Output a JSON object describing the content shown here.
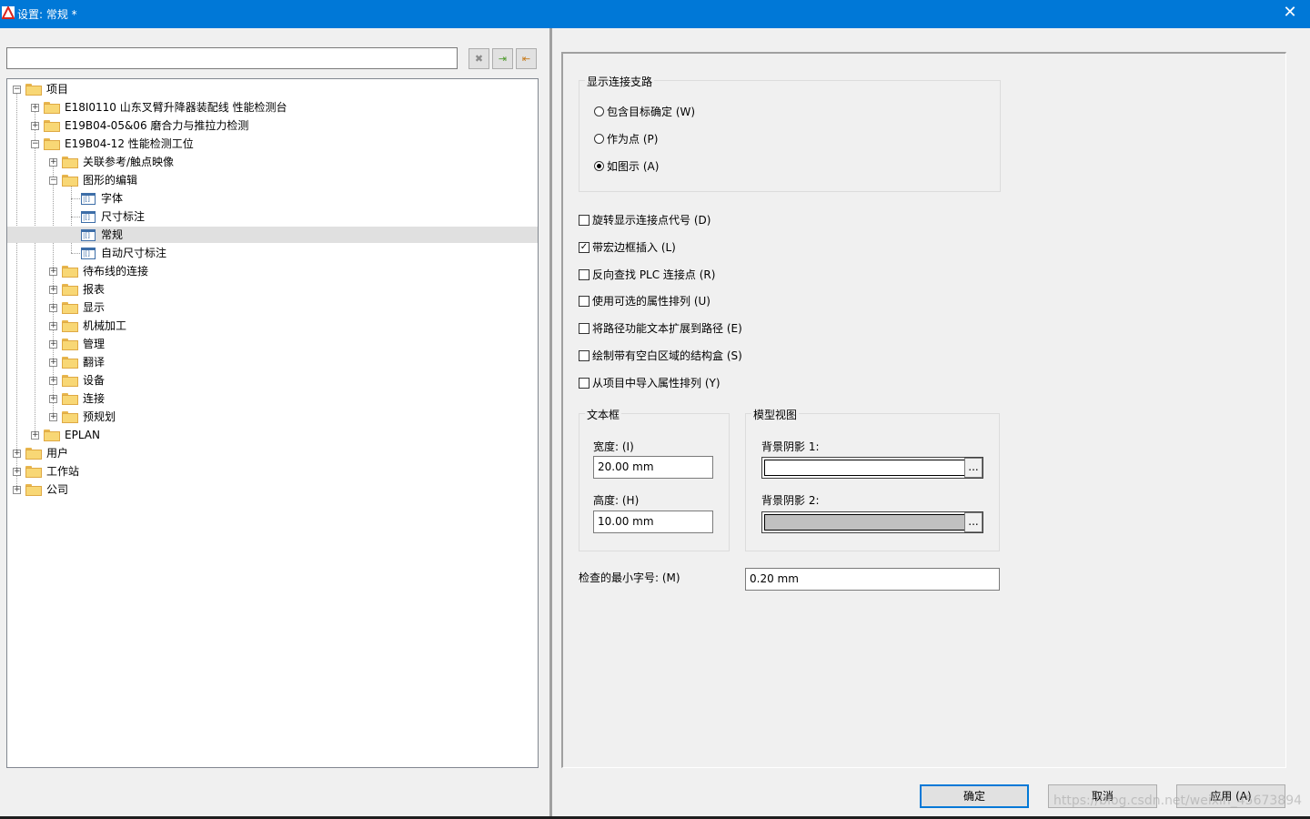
{
  "window": {
    "title": "设置: 常规 *",
    "close_glyph": "✕"
  },
  "search": {
    "value": ""
  },
  "toolbar": {
    "clear_glyph": "✖",
    "import_glyph": "⇥",
    "export_glyph": "⇤"
  },
  "tree": {
    "nodes": [
      {
        "label": "项目"
      },
      {
        "label": "E18I0110 山东叉臂升降器装配线 性能检测台"
      },
      {
        "label": "E19B04-05&06 磨合力与推拉力检测"
      },
      {
        "label": "E19B04-12 性能检测工位"
      },
      {
        "label": "关联参考/触点映像"
      },
      {
        "label": "图形的编辑"
      },
      {
        "label": "字体"
      },
      {
        "label": "尺寸标注"
      },
      {
        "label": "常规"
      },
      {
        "label": "自动尺寸标注"
      },
      {
        "label": "待布线的连接"
      },
      {
        "label": "报表"
      },
      {
        "label": "显示"
      },
      {
        "label": "机械加工"
      },
      {
        "label": "管理"
      },
      {
        "label": "翻译"
      },
      {
        "label": "设备"
      },
      {
        "label": "连接"
      },
      {
        "label": "预规划"
      },
      {
        "label": "EPLAN"
      },
      {
        "label": "用户"
      },
      {
        "label": "工作站"
      },
      {
        "label": "公司"
      }
    ]
  },
  "settings": {
    "connection_group": {
      "title": "显示连接支路",
      "options": [
        {
          "label": "包含目标确定 (W)",
          "selected": false
        },
        {
          "label": "作为点 (P)",
          "selected": false
        },
        {
          "label": "如图示 (A)",
          "selected": true
        }
      ]
    },
    "checkboxes": [
      {
        "label": "旋转显示连接点代号 (D)",
        "checked": false
      },
      {
        "label": "带宏边框插入 (L)",
        "checked": true
      },
      {
        "label": "反向查找 PLC 连接点 (R)",
        "checked": false
      },
      {
        "label": "使用可选的属性排列 (U)",
        "checked": false
      },
      {
        "label": "将路径功能文本扩展到路径 (E)",
        "checked": false
      },
      {
        "label": "绘制带有空白区域的结构盒 (S)",
        "checked": false
      },
      {
        "label": "从项目中导入属性排列 (Y)",
        "checked": false
      }
    ],
    "textbox_group": {
      "title": "文本框",
      "width_label": "宽度: (I)",
      "width_value": "20.00 mm",
      "height_label": "高度: (H)",
      "height_value": "10.00 mm"
    },
    "model_view_group": {
      "title": "模型视图",
      "bg1_label": "背景阴影 1:",
      "bg1_color": "#ffffff",
      "bg2_label": "背景阴影 2:",
      "bg2_color": "#c0c0c0",
      "ellipsis": "..."
    },
    "min_font": {
      "label": "检查的最小字号: (M)",
      "value": "0.20 mm"
    }
  },
  "buttons": {
    "ok": "确定",
    "cancel": "取消",
    "apply": "应用 (A)"
  },
  "watermark": "https://blog.csdn.net/weixin_45673894"
}
